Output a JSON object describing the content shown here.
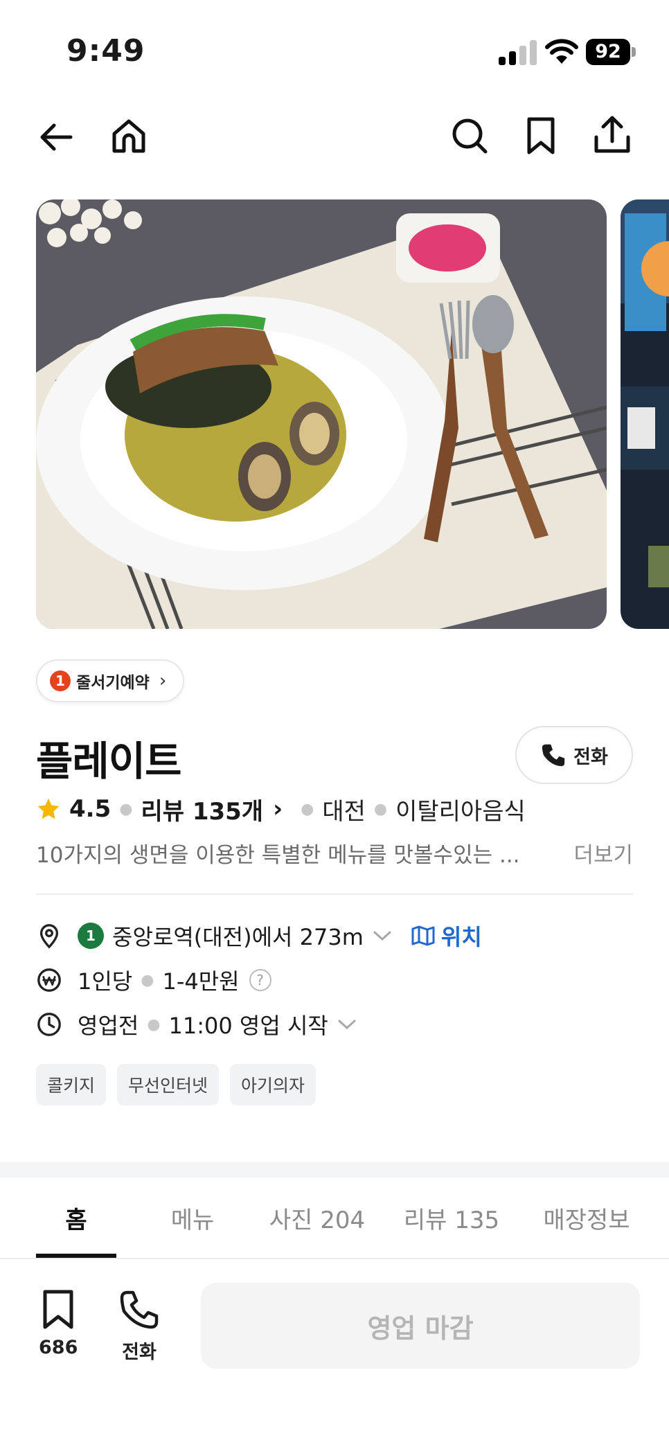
{
  "status_bar": {
    "time": "9:49",
    "battery": "92"
  },
  "store": {
    "queue_badge_count": "1",
    "queue_label": "줄서기예약",
    "name": "플레이트",
    "call_label": "전화",
    "rating": "4.5",
    "review_link": "리뷰 135개",
    "region": "대전",
    "category": "이탈리아음식",
    "description": "10가지의 생면을 이용한 특별한 메뉴를 맛볼수있는 ...",
    "more_label": "더보기"
  },
  "info": {
    "subway_line": "1",
    "subway_text": "중앙로역(대전)에서 273m",
    "location_link": "위치",
    "price_label": "1인당",
    "price_value": "1-4만원",
    "hours_status": "영업전",
    "hours_text": "11:00 영업 시작"
  },
  "tags": [
    "콜키지",
    "무선인터넷",
    "아기의자"
  ],
  "tabs": [
    {
      "label": "홈",
      "active": true
    },
    {
      "label": "메뉴"
    },
    {
      "label": "사진 204"
    },
    {
      "label": "리뷰 135"
    },
    {
      "label": "매장정보"
    }
  ],
  "bottom_bar": {
    "save_count": "686",
    "call_label": "전화",
    "action_label": "영업 마감"
  },
  "colors": {
    "accent_blue": "#1f67d1",
    "queue_red": "#e5431f",
    "subway_green": "#1b7a3d",
    "star_yellow": "#f5b800"
  }
}
